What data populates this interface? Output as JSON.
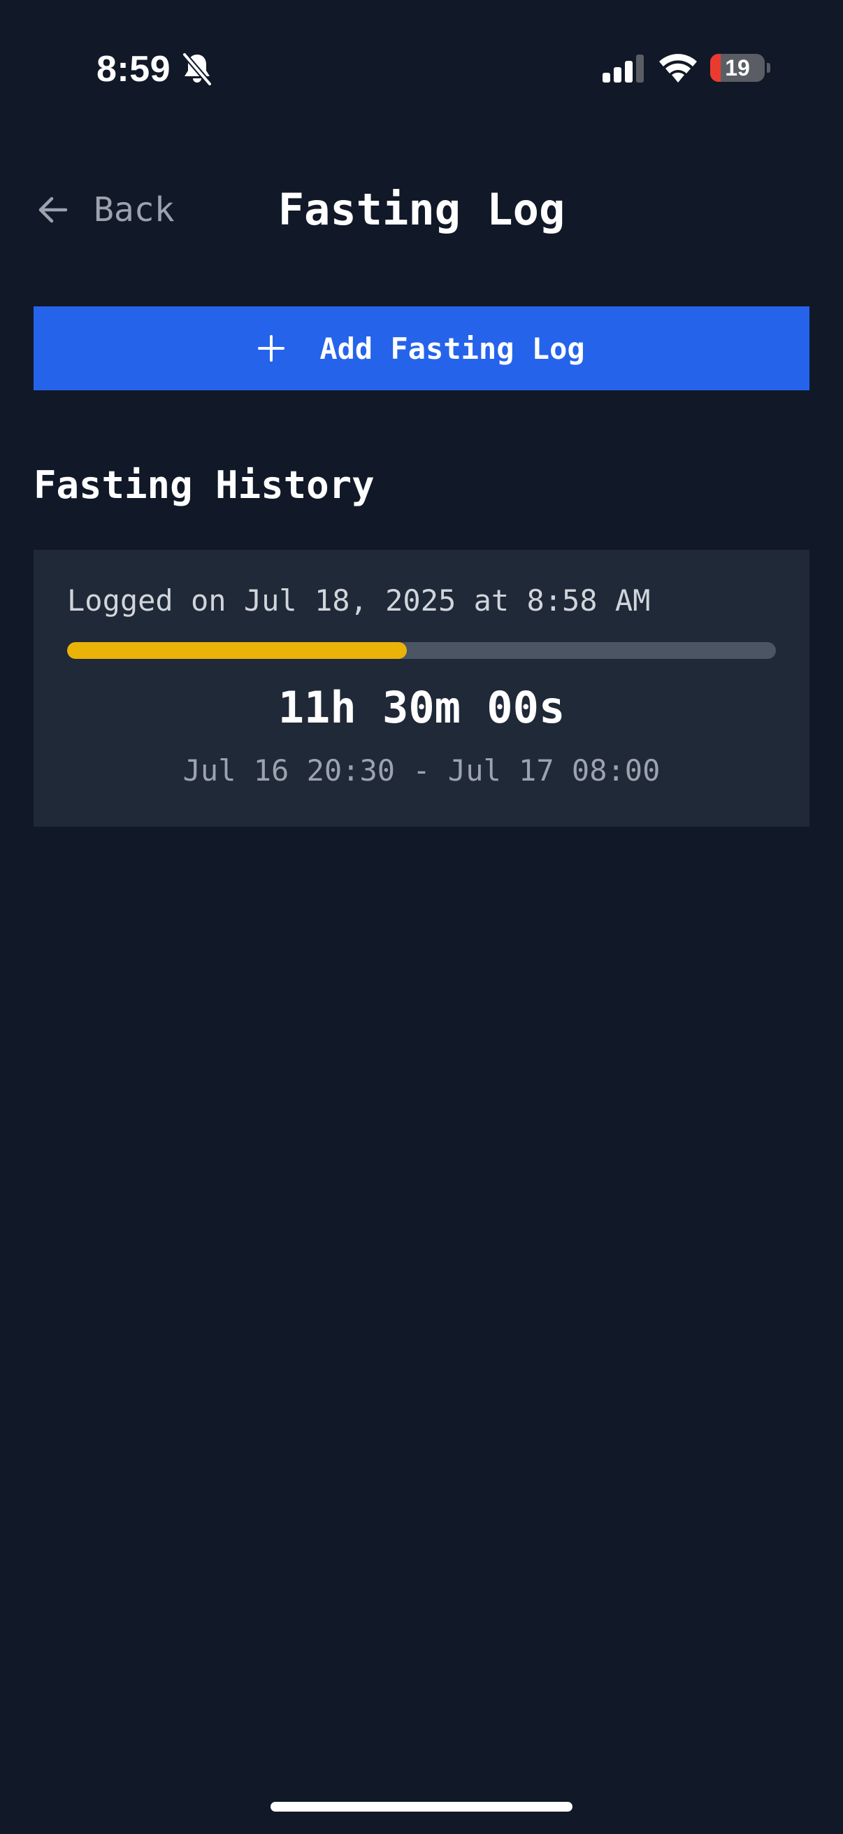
{
  "status_bar": {
    "time": "8:59",
    "battery_level": "19",
    "battery_fraction": 0.19,
    "icons": [
      "bell-slash-icon",
      "cellular-signal-icon",
      "wifi-icon",
      "battery-icon"
    ]
  },
  "header": {
    "back_label": "Back",
    "title": "Fasting Log",
    "back_icon": "arrow-left-icon"
  },
  "add_button": {
    "icon": "plus-icon",
    "label": "Add Fasting Log"
  },
  "history": {
    "title": "Fasting History",
    "entries": [
      {
        "logged_on": "Logged on Jul 18, 2025 at 8:58 AM",
        "progress_fraction": 0.479,
        "duration": "11h 30m 00s",
        "range": "Jul 16 20:30 - Jul 17 08:00"
      }
    ]
  },
  "colors": {
    "background": "#111827",
    "card": "#1f2937",
    "accent": "#2563eb",
    "progress": "#eab308",
    "track": "#4b5563",
    "battery_low": "#eb3b30"
  }
}
